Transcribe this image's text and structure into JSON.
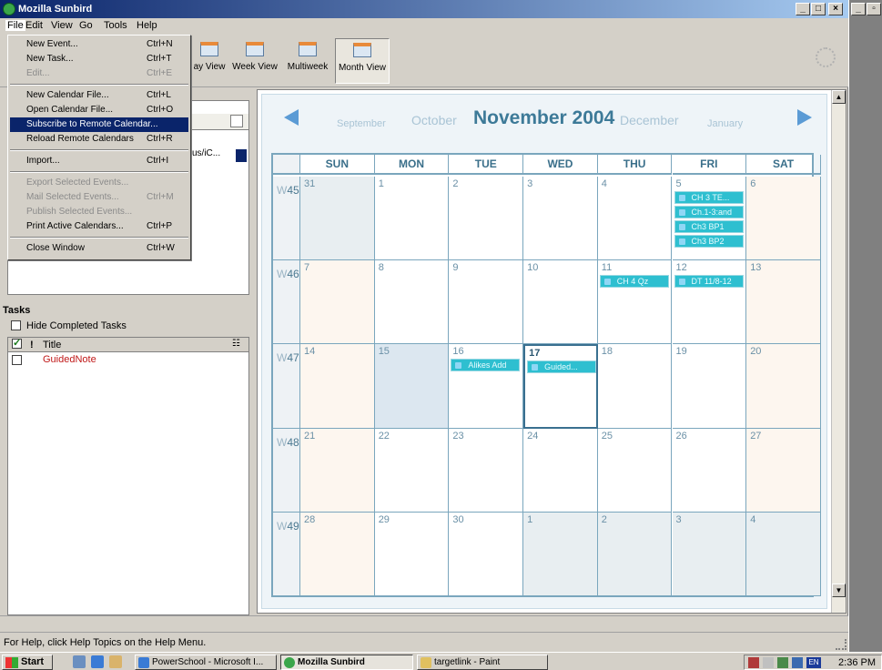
{
  "window": {
    "title": "Mozilla Sunbird"
  },
  "menubar": [
    "File",
    "Edit",
    "View",
    "Go",
    "Tools",
    "Help"
  ],
  "file_menu": {
    "items": [
      {
        "label": "New Event...",
        "shortcut": "Ctrl+N",
        "enabled": true
      },
      {
        "label": "New Task...",
        "shortcut": "Ctrl+T",
        "enabled": true
      },
      {
        "label": "Edit...",
        "shortcut": "Ctrl+E",
        "enabled": false
      },
      {
        "label": "New Calendar File...",
        "shortcut": "Ctrl+L",
        "enabled": true
      },
      {
        "label": "Open Calendar File...",
        "shortcut": "Ctrl+O",
        "enabled": true
      },
      {
        "label": "Subscribe to Remote Calendar...",
        "shortcut": "",
        "enabled": true,
        "highlighted": true
      },
      {
        "label": "Reload Remote Calendars",
        "shortcut": "Ctrl+R",
        "enabled": true
      },
      {
        "label": "Import...",
        "shortcut": "Ctrl+I",
        "enabled": true
      },
      {
        "label": "Export Selected Events...",
        "shortcut": "",
        "enabled": false
      },
      {
        "label": "Mail Selected Events...",
        "shortcut": "Ctrl+M",
        "enabled": false
      },
      {
        "label": "Publish Selected Events...",
        "shortcut": "",
        "enabled": false
      },
      {
        "label": "Print Active Calendars...",
        "shortcut": "Ctrl+P",
        "enabled": true
      },
      {
        "label": "Close Window",
        "shortcut": "Ctrl+W",
        "enabled": true
      }
    ]
  },
  "toolbar": {
    "day_view": "ay View",
    "week_view": "Week View",
    "multiweek": "Multiweek",
    "month_view": "Month View"
  },
  "calendar_list": {
    "entry": "us/iC..."
  },
  "tasks": {
    "title": "Tasks",
    "hide_completed": "Hide Completed Tasks",
    "col_priority": "!",
    "col_title": "Title",
    "items": [
      "GuidedNote"
    ]
  },
  "month_nav": {
    "prev2": "September",
    "prev1": "October",
    "current": "November 2004",
    "next1": "December",
    "next2": "January"
  },
  "weekdays": [
    "SUN",
    "MON",
    "TUE",
    "WED",
    "THU",
    "FRI",
    "SAT"
  ],
  "weeks": [
    {
      "label_prefix": "W",
      "label_num": "45",
      "days": [
        "31",
        "1",
        "2",
        "3",
        "4",
        "5",
        "6"
      ]
    },
    {
      "label_prefix": "W",
      "label_num": "46",
      "days": [
        "7",
        "8",
        "9",
        "10",
        "11",
        "12",
        "13"
      ]
    },
    {
      "label_prefix": "W",
      "label_num": "47",
      "days": [
        "14",
        "15",
        "16",
        "17",
        "18",
        "19",
        "20"
      ]
    },
    {
      "label_prefix": "W",
      "label_num": "48",
      "days": [
        "21",
        "22",
        "23",
        "24",
        "25",
        "26",
        "27"
      ]
    },
    {
      "label_prefix": "W",
      "label_num": "49",
      "days": [
        "28",
        "29",
        "30",
        "1",
        "2",
        "3",
        "4"
      ]
    }
  ],
  "events": [
    {
      "week": 0,
      "day": 5,
      "slot": 0,
      "title": "CH 3 TE..."
    },
    {
      "week": 0,
      "day": 5,
      "slot": 1,
      "title": "Ch.1-3:and"
    },
    {
      "week": 0,
      "day": 5,
      "slot": 2,
      "title": "Ch3 BP1"
    },
    {
      "week": 0,
      "day": 5,
      "slot": 3,
      "title": "Ch3 BP2"
    },
    {
      "week": 1,
      "day": 4,
      "slot": 0,
      "title": "CH 4 Qz"
    },
    {
      "week": 1,
      "day": 5,
      "slot": 0,
      "title": "DT 11/8-12"
    },
    {
      "week": 2,
      "day": 2,
      "slot": 0,
      "title": "Alikes Add"
    },
    {
      "week": 2,
      "day": 3,
      "slot": 0,
      "title": "Guided..."
    }
  ],
  "status": {
    "text": "For Help, click Help Topics on the Help Menu."
  },
  "taskbar": {
    "start": "Start",
    "buttons": [
      "PowerSchool - Microsoft I...",
      "Mozilla Sunbird",
      "targetlink - Paint"
    ],
    "tray_lang": "EN",
    "clock": "2:36 PM"
  },
  "colors": {
    "event": "#2ebfd0",
    "titlebar": "#0a246a",
    "grid_border": "#7aa6bd"
  }
}
